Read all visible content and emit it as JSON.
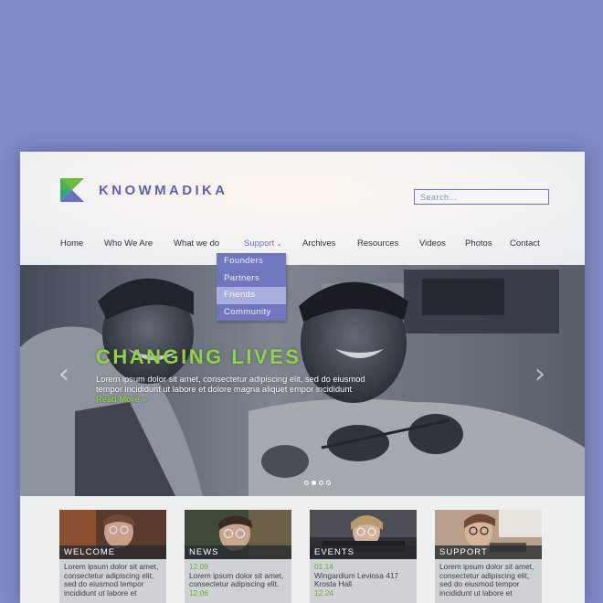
{
  "brand": {
    "name": "KNOWMADIKA"
  },
  "search": {
    "placeholder": "Search..."
  },
  "nav": {
    "items": [
      "Home",
      "Who We Are",
      "What we do",
      "Support",
      "Archives",
      "Resources",
      "Videos",
      "Photos",
      "Contact"
    ],
    "active": "Support"
  },
  "dropdown": {
    "items": [
      "Founders",
      "Partners",
      "Friends",
      "Community"
    ],
    "highlighted": "Friends"
  },
  "hero": {
    "title": "CHANGING LIVES",
    "body": "Lorem ipsum dolor sit amet, consectetur adipiscing elit, sed do eiusmod tempor incididunt ut labore et dolore magna aliquet empor incididunt",
    "read_more": "Read More »",
    "slides_total": 4,
    "slide_current": 2
  },
  "cards": [
    {
      "label": "WELCOME",
      "date": "",
      "text": "Lorem ipsum dolor sit amet, consectetur adipiscing elit, sed do eiusmod tempor incididunt ut labore et",
      "date2": ""
    },
    {
      "label": "NEWS",
      "date": "12.09",
      "text": "Lorem ipsum dolor sit amet, consectetur adipiscing elit.",
      "date2": "12.06"
    },
    {
      "label": "EVENTS",
      "date": "01.14",
      "text": "Wingardium Leviosa 417 Krosta Hall",
      "date2": "12.24"
    },
    {
      "label": "SUPPORT",
      "date": "",
      "text": "Lorem ipsum dolor sit amet, consectetur adipiscing elit, sed do eiusmod tempor incididunt ut labore et",
      "date2": ""
    }
  ],
  "colors": {
    "background": "#8189c5",
    "accent": "#6b72c0",
    "green": "#8fd34a",
    "dropdown": "#7077bf"
  }
}
